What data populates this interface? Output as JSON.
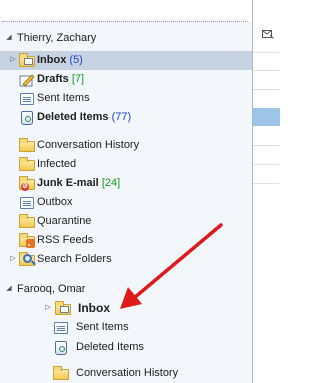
{
  "accounts": [
    {
      "name": "Thierry, Zachary",
      "folders": [
        {
          "label": "Inbox",
          "count": "(5)",
          "count_color": "blue",
          "bold": true,
          "icon": "inbox-icon",
          "twisty": true,
          "selected": true
        },
        {
          "label": "Drafts",
          "count": "[7]",
          "count_color": "green",
          "bold": true,
          "icon": "drafts-icon"
        },
        {
          "label": "Sent Items",
          "count": "",
          "bold": false,
          "icon": "sent-items-icon"
        },
        {
          "label": "Deleted Items",
          "count": "(77)",
          "count_color": "blue",
          "bold": true,
          "icon": "deleted-items-icon"
        },
        {
          "label": "Conversation History",
          "count": "",
          "bold": false,
          "icon": "folder-icon"
        },
        {
          "label": "Infected",
          "count": "",
          "bold": false,
          "icon": "folder-icon"
        },
        {
          "label": "Junk E-mail",
          "count": "[24]",
          "count_color": "green",
          "bold": true,
          "icon": "junk-email-icon"
        },
        {
          "label": "Outbox",
          "count": "",
          "bold": false,
          "icon": "outbox-icon"
        },
        {
          "label": "Quarantine",
          "count": "",
          "bold": false,
          "icon": "folder-icon"
        },
        {
          "label": "RSS Feeds",
          "count": "",
          "bold": false,
          "icon": "rss-feeds-icon"
        },
        {
          "label": "Search Folders",
          "count": "",
          "bold": false,
          "icon": "search-folders-icon",
          "twisty": true
        }
      ]
    },
    {
      "name": "Farooq, Omar",
      "folders": [
        {
          "label": "Inbox",
          "count": "",
          "bold": true,
          "icon": "inbox-icon",
          "twisty": true
        },
        {
          "label": "Sent Items",
          "count": "",
          "bold": false,
          "icon": "sent-items-icon"
        },
        {
          "label": "Deleted Items",
          "count": "",
          "bold": false,
          "icon": "deleted-items-icon"
        },
        {
          "label": "Conversation History",
          "count": "",
          "bold": false,
          "icon": "folder-icon"
        }
      ]
    }
  ],
  "colors": {
    "unread_count": "#1e3fd6",
    "draft_count": "#169a16",
    "annotation_arrow": "#e0191b",
    "selection": "#c7d3e3"
  }
}
